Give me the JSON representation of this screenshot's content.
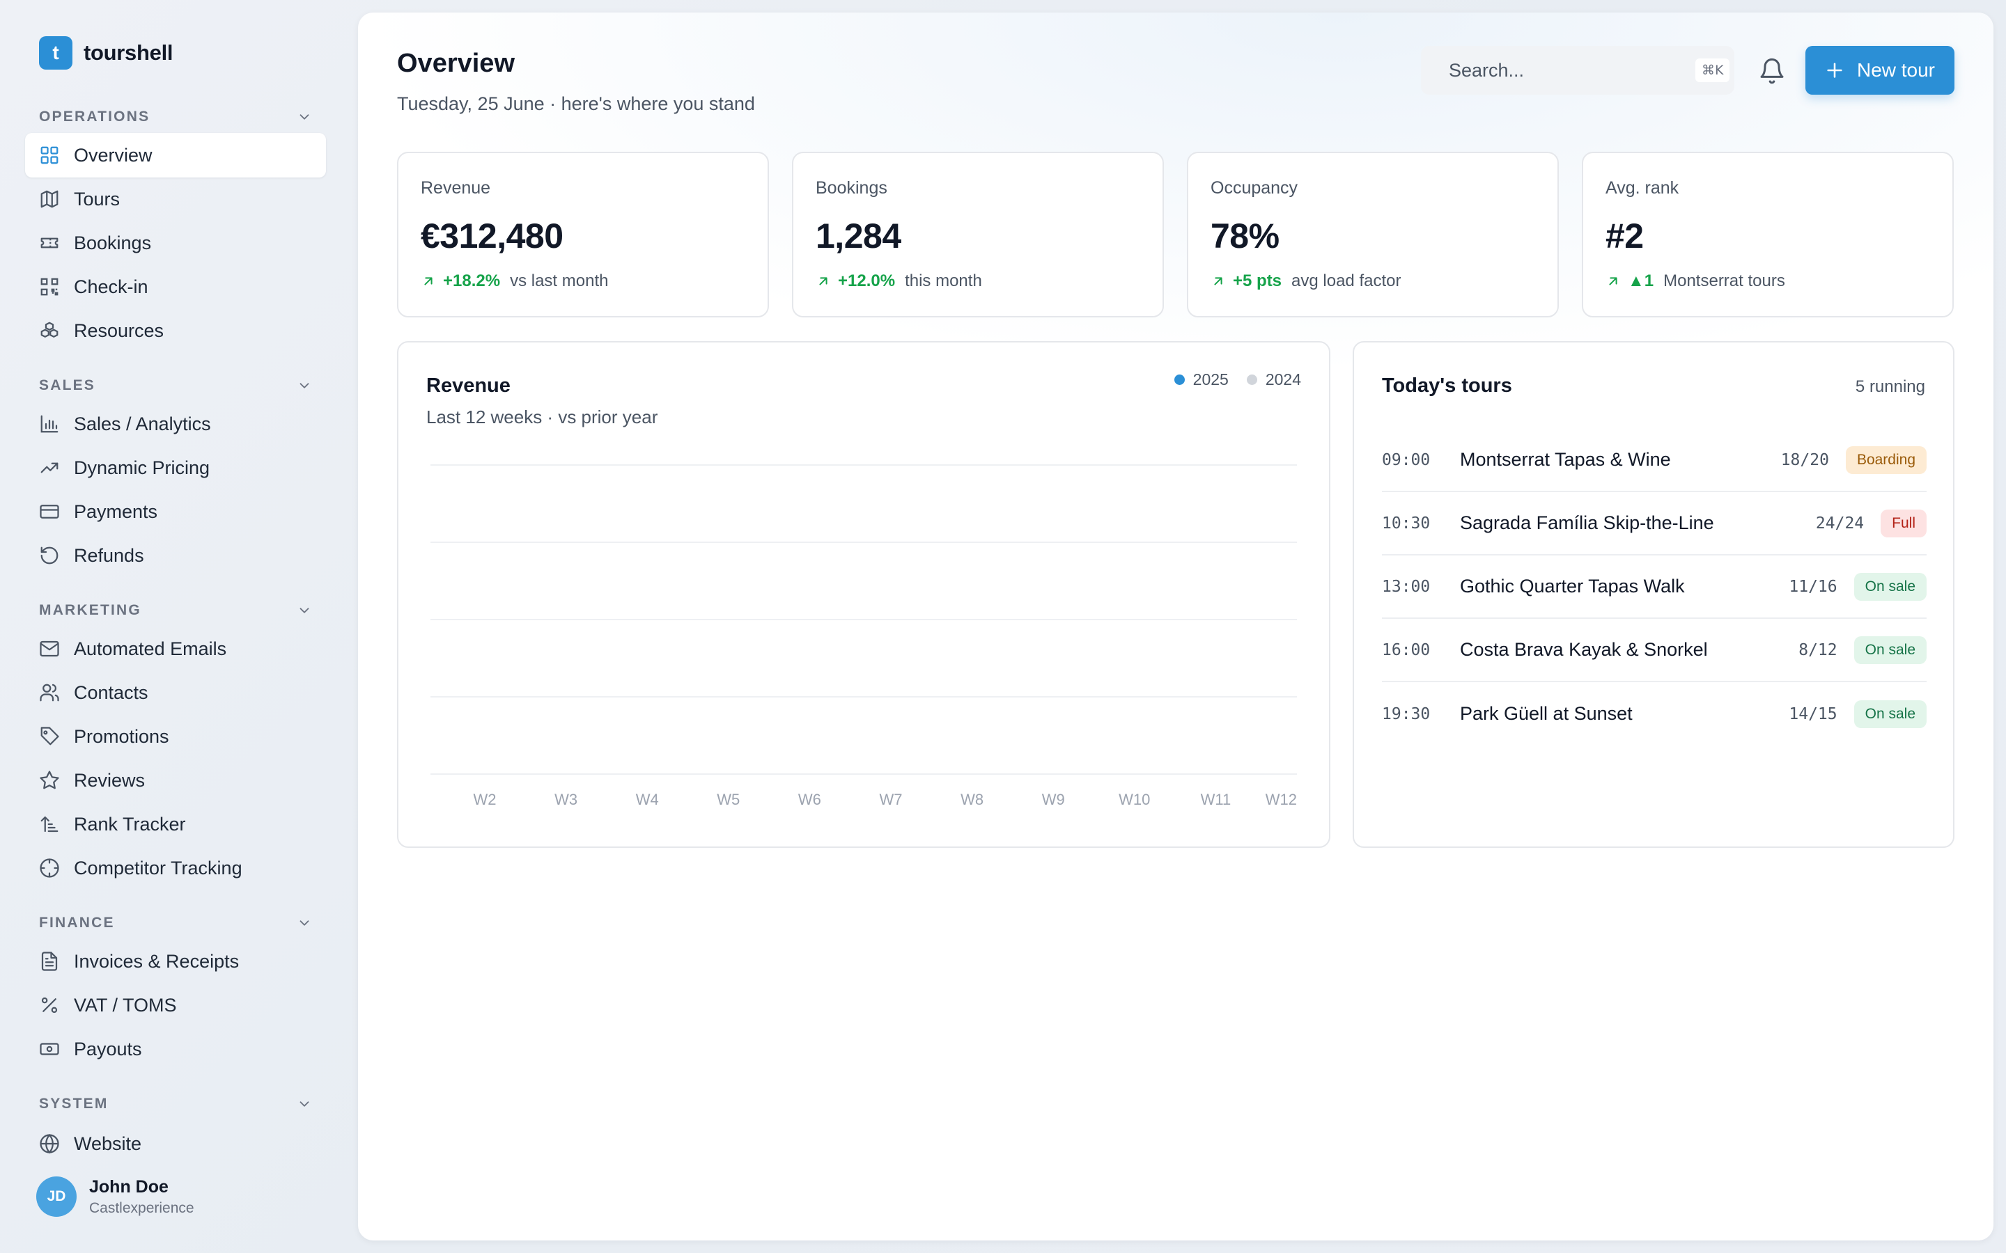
{
  "brand": {
    "logo_letter": "t",
    "name": "tourshell"
  },
  "sidebar": {
    "sections": [
      {
        "title": "OPERATIONS",
        "items": [
          {
            "label": "Overview",
            "icon": "grid-icon",
            "active": true
          },
          {
            "label": "Tours",
            "icon": "map-icon"
          },
          {
            "label": "Bookings",
            "icon": "ticket-icon"
          },
          {
            "label": "Check-in",
            "icon": "qr-icon"
          },
          {
            "label": "Resources",
            "icon": "boxes-icon"
          }
        ]
      },
      {
        "title": "SALES",
        "items": [
          {
            "label": "Sales / Analytics",
            "icon": "bar-chart-icon"
          },
          {
            "label": "Dynamic Pricing",
            "icon": "trending-up-icon"
          },
          {
            "label": "Payments",
            "icon": "credit-card-icon"
          },
          {
            "label": "Refunds",
            "icon": "rotate-ccw-icon"
          }
        ]
      },
      {
        "title": "MARKETING",
        "items": [
          {
            "label": "Automated Emails",
            "icon": "mail-icon"
          },
          {
            "label": "Contacts",
            "icon": "users-icon"
          },
          {
            "label": "Promotions",
            "icon": "tag-icon"
          },
          {
            "label": "Reviews",
            "icon": "star-icon"
          },
          {
            "label": "Rank Tracker",
            "icon": "sort-icon"
          },
          {
            "label": "Competitor Tracking",
            "icon": "crosshair-icon"
          }
        ]
      },
      {
        "title": "FINANCE",
        "items": [
          {
            "label": "Invoices & Receipts",
            "icon": "file-text-icon"
          },
          {
            "label": "VAT / TOMS",
            "icon": "percent-icon"
          },
          {
            "label": "Payouts",
            "icon": "banknote-icon"
          }
        ]
      },
      {
        "title": "SYSTEM",
        "items": [
          {
            "label": "Website",
            "icon": "globe-icon"
          }
        ]
      }
    ],
    "user": {
      "initials": "JD",
      "name": "John Doe",
      "org": "Castlexperience"
    }
  },
  "header": {
    "title": "Overview",
    "subtitle": "Tuesday, 25 June · here's where you stand",
    "search_placeholder": "Search...",
    "search_shortcut": "⌘K",
    "new_button": "New tour"
  },
  "kpis": [
    {
      "label": "Revenue",
      "value": "€312,480",
      "delta": "+18.2%",
      "note": "vs last month"
    },
    {
      "label": "Bookings",
      "value": "1,284",
      "delta": "+12.0%",
      "note": "this month"
    },
    {
      "label": "Occupancy",
      "value": "78%",
      "delta": "+5 pts",
      "note": "avg load factor"
    },
    {
      "label": "Avg. rank",
      "value": "#2",
      "delta": "▲1",
      "note": "Montserrat tours"
    }
  ],
  "revenue_card": {
    "title": "Revenue",
    "subtitle": "Last 12 weeks · vs prior year",
    "legend": [
      {
        "label": "2025",
        "color": "#2b8fd6"
      },
      {
        "label": "2024",
        "color": "#d1d5db"
      }
    ]
  },
  "chart_data": {
    "type": "line",
    "title": "Revenue",
    "subtitle": "Last 12 weeks · vs prior year",
    "categories": [
      "W2",
      "W3",
      "W4",
      "W5",
      "W6",
      "W7",
      "W8",
      "W9",
      "W10",
      "W11",
      "W12"
    ],
    "series": [
      {
        "name": "2025",
        "color": "#2b8fd6",
        "values": []
      },
      {
        "name": "2024",
        "color": "#d1d5db",
        "values": []
      }
    ],
    "grid": true,
    "legend_position": "top-right"
  },
  "tours": {
    "title": "Today's tours",
    "count": "5 running",
    "rows": [
      {
        "time": "09:00",
        "name": "Montserrat Tapas & Wine",
        "capacity": "18/20",
        "status": "Boarding",
        "status_kind": "boarding"
      },
      {
        "time": "10:30",
        "name": "Sagrada Família Skip-the-Line",
        "capacity": "24/24",
        "status": "Full",
        "status_kind": "full"
      },
      {
        "time": "13:00",
        "name": "Gothic Quarter Tapas Walk",
        "capacity": "11/16",
        "status": "On sale",
        "status_kind": "sale"
      },
      {
        "time": "16:00",
        "name": "Costa Brava Kayak & Snorkel",
        "capacity": "8/12",
        "status": "On sale",
        "status_kind": "sale"
      },
      {
        "time": "19:30",
        "name": "Park Güell at Sunset",
        "capacity": "14/15",
        "status": "On sale",
        "status_kind": "sale"
      }
    ]
  }
}
